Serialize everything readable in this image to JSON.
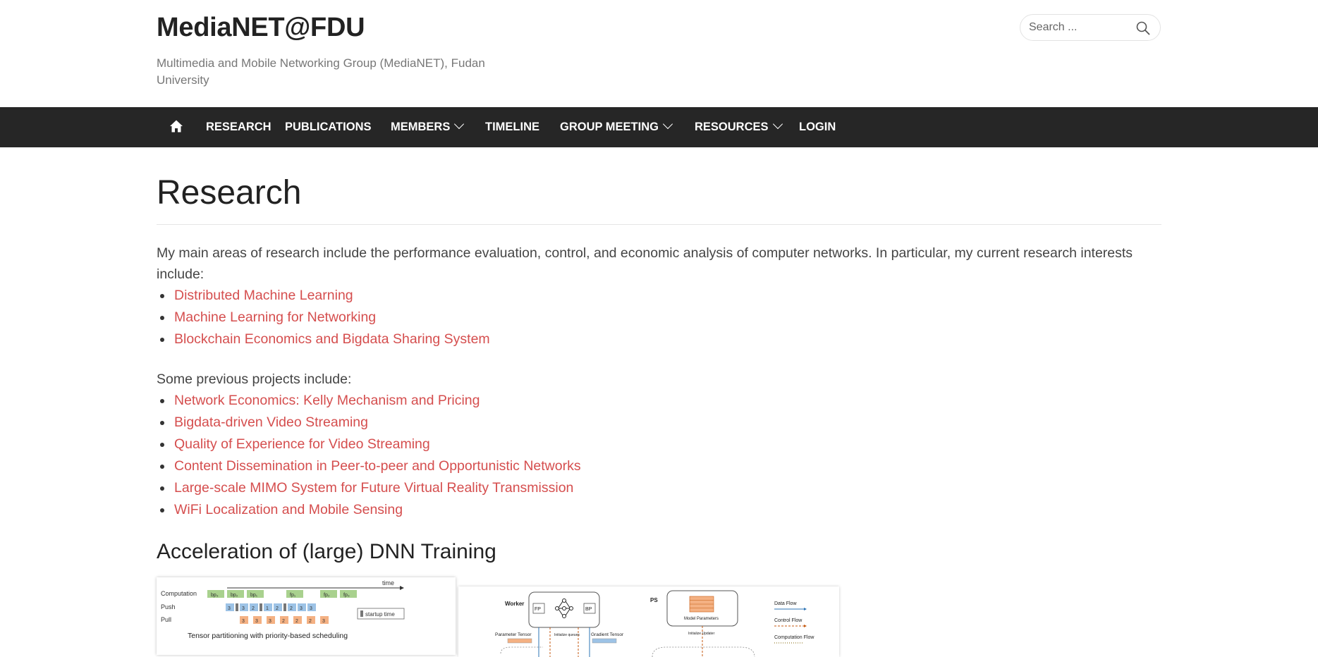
{
  "site": {
    "title": "MediaNET@FDU",
    "description": "Multimedia and Mobile Networking Group (MediaNET), Fudan University"
  },
  "search": {
    "placeholder": "Search ..."
  },
  "nav": {
    "items": [
      {
        "label": "Research"
      },
      {
        "label": "Publications"
      },
      {
        "label": "Members"
      },
      {
        "label": "Timeline"
      },
      {
        "label": "Group Meeting"
      },
      {
        "label": "Resources"
      },
      {
        "label": "Login"
      }
    ]
  },
  "page": {
    "title": "Research",
    "intro": "My main areas of research include the performance evaluation, control, and economic analysis of computer networks. In particular, my current research interests include:",
    "current_interests": [
      "Distributed Machine Learning",
      "Machine Learning for Networking",
      "Blockchain Economics and Bigdata Sharing System"
    ],
    "previous_intro": "Some previous projects include:",
    "previous_projects": [
      "Network Economics: Kelly Mechanism and Pricing",
      "Bigdata-driven Video Streaming",
      "Quality of Experience for Video Streaming",
      "Content Dissemination in Peer-to-peer and Opportunistic Networks",
      "Large-scale MIMO System for Future Virtual Reality Transmission",
      "WiFi Localization and Mobile Sensing"
    ],
    "section_title": "Acceleration of (large) DNN Training"
  },
  "figure1": {
    "time_label": "time",
    "row_labels": [
      "Computation",
      "Push",
      "Pull"
    ],
    "compute_blocks": [
      "bp₃",
      "bp₂",
      "bp₁",
      "fp₁",
      "fp₂",
      "fp₃"
    ],
    "push_blocks": [
      "3",
      "3",
      "2",
      "1",
      "2",
      "2",
      "3",
      "3"
    ],
    "pull_blocks": [
      "3",
      "3",
      "3",
      "2",
      "2",
      "2",
      "3"
    ],
    "legend": "startup time",
    "caption": "Tensor partitioning with priority-based scheduling"
  },
  "figure2": {
    "worker_label": "Worker",
    "fp": "FP",
    "bp": "BP",
    "ps_label": "PS",
    "model_params": "Model Parameters",
    "param_tensor": "Parameter Tensor",
    "grad_tensor": "Gradient Tensor",
    "init_queues": "Initialize queues",
    "init_updater": "Initialize Updater",
    "legend": [
      "Data Flow",
      "Control Flow",
      "Computation Flow"
    ]
  },
  "colors": {
    "link": "#d54e4e",
    "nav_bg": "#262626",
    "compute": "#a9d18e",
    "push": "#9dc3e6",
    "pull": "#f4b183"
  }
}
